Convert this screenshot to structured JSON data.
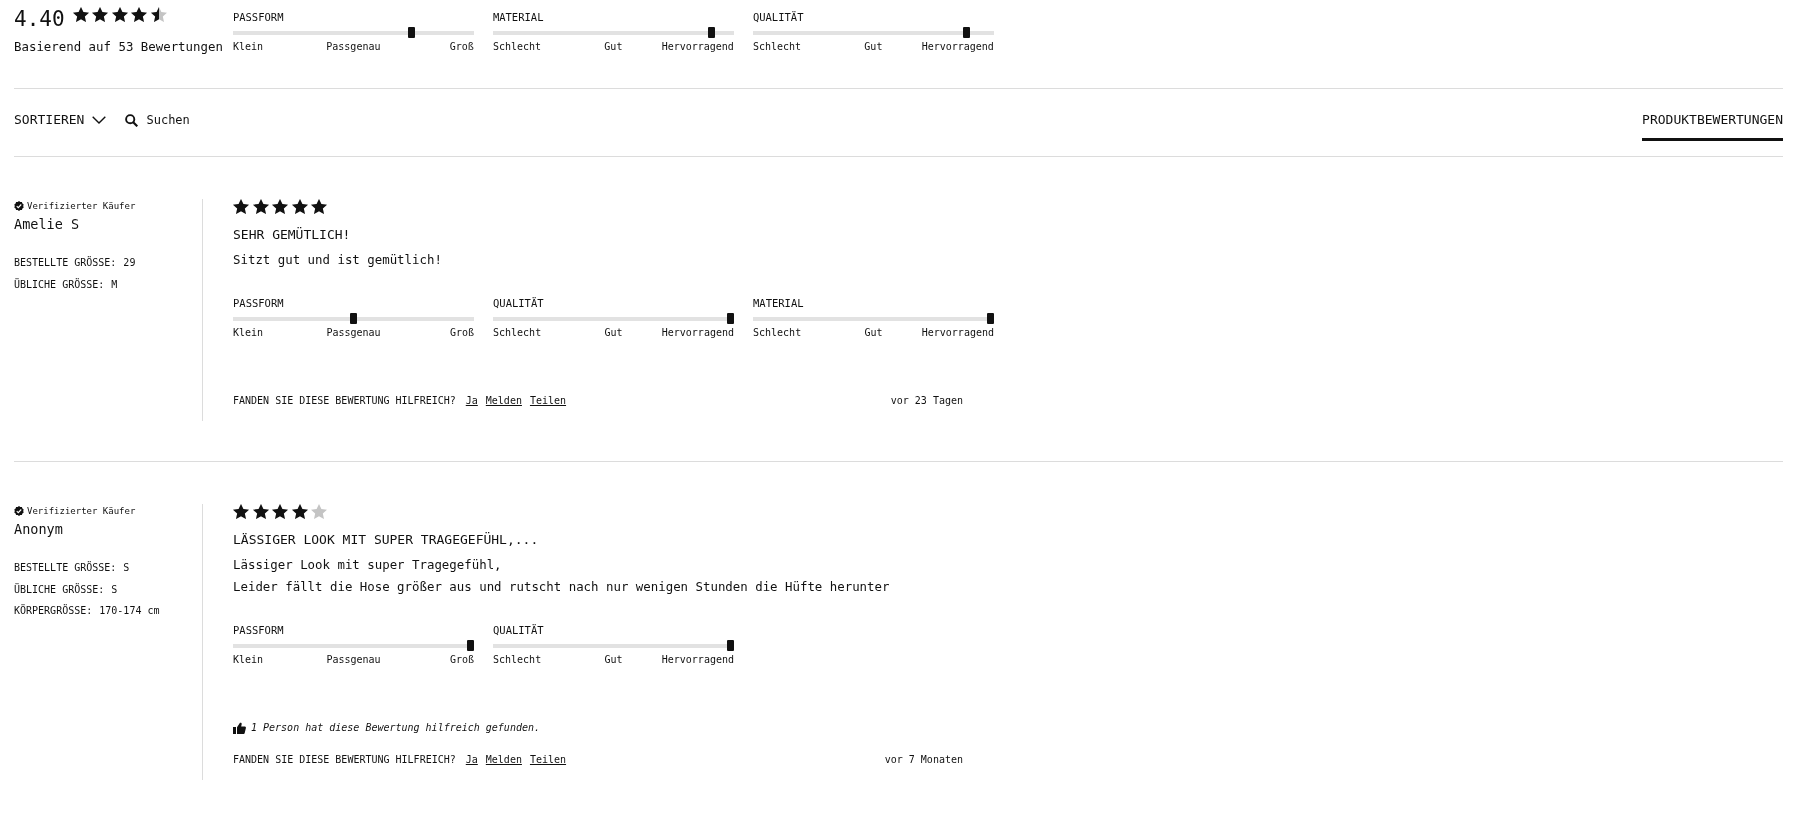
{
  "summary": {
    "average": "4.40",
    "stars": 4.5,
    "count": "Basierend auf 53 Bewertungen",
    "sliders": [
      {
        "label": "PASSFORM",
        "level": 0.75,
        "scale": [
          "Klein",
          "Passgenau",
          "Groß"
        ]
      },
      {
        "label": "MATERIAL",
        "level": 0.92,
        "scale": [
          "Schlecht",
          "Gut",
          "Hervorragend"
        ]
      },
      {
        "label": "QUALITÄT",
        "level": 0.9,
        "scale": [
          "Schlecht",
          "Gut",
          "Hervorragend"
        ]
      }
    ]
  },
  "toolbar": {
    "sort": "SORTIEREN",
    "search": "Suchen",
    "tabs": [
      {
        "label": "PRODUKTBEWERTUNGEN",
        "selected": true
      }
    ]
  },
  "reviews": [
    {
      "badge": "Verifizierter Käufer",
      "author": "Amelie S",
      "attributes": [
        {
          "label": "BESTELLTE GRÖSSE:",
          "value": "29"
        },
        {
          "label": "ÜBLICHE GRÖSSE:",
          "value": "M"
        }
      ],
      "stars": 5,
      "title": "SEHR GEMÜTLICH!",
      "body": "Sitzt gut und ist gemütlich!",
      "sliders": [
        {
          "label": "PASSFORM",
          "level": 0.5,
          "scale": [
            "Klein",
            "Passgenau",
            "Groß"
          ]
        },
        {
          "label": "QUALITÄT",
          "level": 1,
          "scale": [
            "Schlecht",
            "Gut",
            "Hervorragend"
          ]
        },
        {
          "label": "MATERIAL",
          "level": 1,
          "scale": [
            "Schlecht",
            "Gut",
            "Hervorragend"
          ]
        }
      ],
      "question": "FANDEN SIE DIESE BEWERTUNG HILFREICH?",
      "actions": [
        "Ja",
        "Melden",
        "Teilen"
      ],
      "date": "vor 23 Tagen"
    },
    {
      "badge": "Verifizierter Käufer",
      "author": "Anonym",
      "attributes": [
        {
          "label": "BESTELLTE GRÖSSE:",
          "value": "S"
        },
        {
          "label": "ÜBLICHE GRÖSSE:",
          "value": "S"
        },
        {
          "label": "KÖRPERGRÖSSE:",
          "value": "170-174 cm"
        }
      ],
      "stars": 4,
      "title": "LÄSSIGER LOOK MIT SUPER TRAGEGEFÜHL,...",
      "body": "Lässiger Look mit super Tragegefühl,\nLeider fällt die Hose größer aus und rutscht nach nur wenigen Stunden die Hüfte herunter",
      "sliders": [
        {
          "label": "PASSFORM",
          "level": 1,
          "scale": [
            "Klein",
            "Passgenau",
            "Groß"
          ]
        },
        {
          "label": "QUALITÄT",
          "level": 1,
          "scale": [
            "Schlecht",
            "Gut",
            "Hervorragend"
          ]
        }
      ],
      "helpful_note": "1 Person hat diese Bewertung hilfreich gefunden.",
      "question": "FANDEN SIE DIESE BEWERTUNG HILFREICH?",
      "actions": [
        "Ja",
        "Melden",
        "Teilen"
      ],
      "date": "vor 7 Monaten"
    }
  ]
}
